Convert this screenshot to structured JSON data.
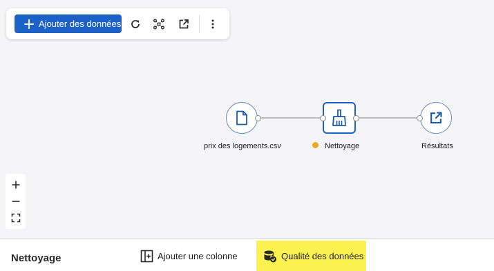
{
  "toolbar": {
    "add_data_label": "Ajouter des données",
    "icons": [
      "plus-icon",
      "refresh-icon",
      "graph-layout-icon",
      "open-external-icon",
      "more-vertical-icon"
    ]
  },
  "workflow": {
    "nodes": [
      {
        "id": "source",
        "label": "prix des logements.csv",
        "icon": "file-icon"
      },
      {
        "id": "cleaning",
        "label": "Nettoyage",
        "icon": "broom-icon",
        "status_color": "#f5a623"
      },
      {
        "id": "output",
        "label": "Résultats",
        "icon": "open-external-icon"
      }
    ]
  },
  "zoom_controls": {
    "icons": [
      "zoom-in-icon",
      "zoom-out-icon",
      "fit-view-icon"
    ]
  },
  "bottom_panel": {
    "title": "Nettoyage",
    "actions": [
      {
        "label": "Ajouter une colonne",
        "icon": "add-column-icon"
      },
      {
        "label": "Qualité des données",
        "icon": "database-check-icon",
        "highlighted": true
      }
    ]
  },
  "colors": {
    "primary": "#1c61c6",
    "canvas_bg": "#f5f5f7",
    "highlight": "#fbf24f",
    "status_pending": "#f5a623"
  }
}
